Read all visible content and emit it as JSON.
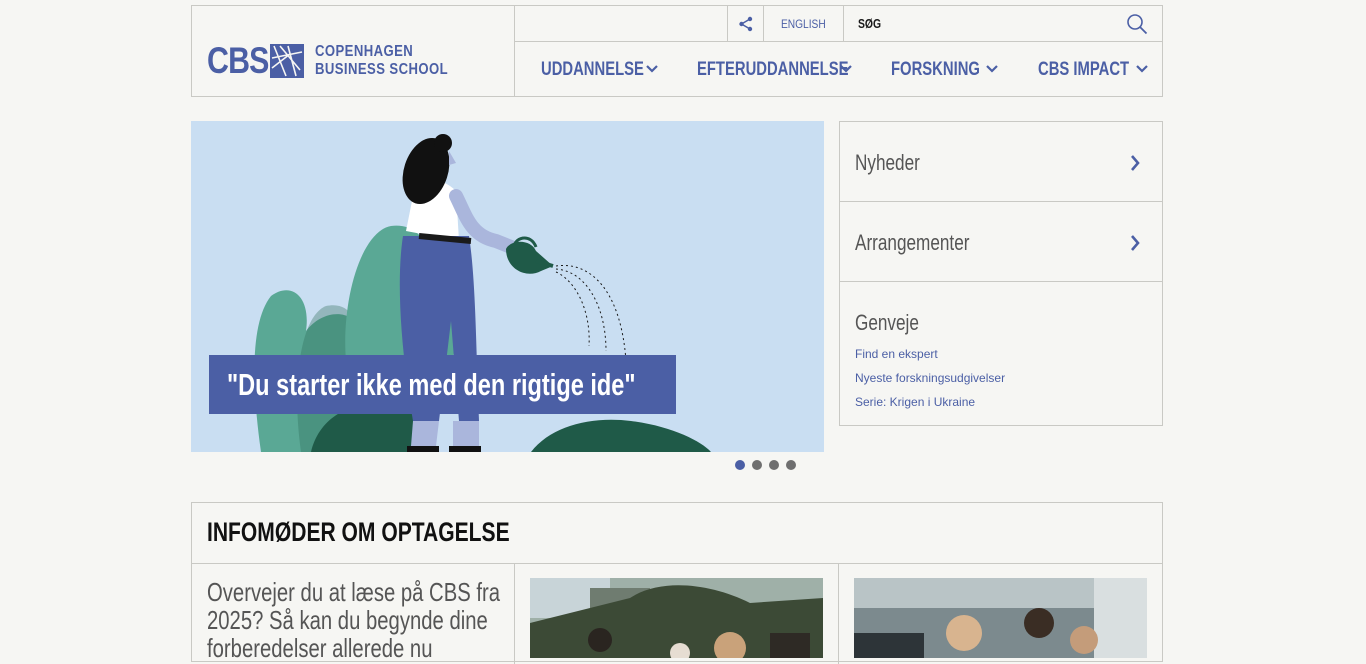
{
  "logo": {
    "cbs": "CBS",
    "line1": "COPENHAGEN",
    "line2": "BUSINESS SCHOOL"
  },
  "topbar": {
    "language": "ENGLISH",
    "search_label": "SØG"
  },
  "nav": [
    {
      "label": "UDDANNELSE"
    },
    {
      "label": "EFTERUDDANNELSE"
    },
    {
      "label": "FORSKNING"
    },
    {
      "label": "CBS IMPACT"
    }
  ],
  "hero": {
    "caption": "\"Du starter ikke med den rigtige ide\"",
    "slide_count": 4,
    "active_slide": 1
  },
  "side": {
    "links": [
      {
        "label": "Nyheder"
      },
      {
        "label": "Arrangementer"
      }
    ],
    "shortcuts_title": "Genveje",
    "shortcuts": [
      "Find en ekspert",
      "Nyeste forskningsudgivelser",
      "Serie: Krigen i Ukraine"
    ]
  },
  "info": {
    "title": "INFOMØDER OM OPTAGELSE",
    "text": "Overvejer du at læse på CBS fra 2025? Så kan du begynde dine forberedelser allerede nu"
  },
  "colors": {
    "brand": "#4b5fa5",
    "background": "#f6f6f3",
    "hero_bg": "#c9def2",
    "border": "#c9c9c4"
  }
}
